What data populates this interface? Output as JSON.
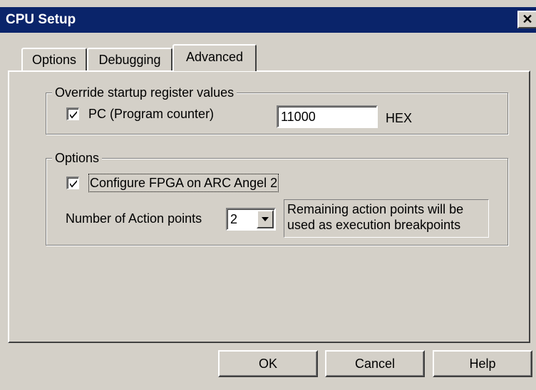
{
  "window": {
    "title": "CPU Setup",
    "close_glyph": "✕"
  },
  "tabs": [
    {
      "label": "Options",
      "active": false
    },
    {
      "label": "Debugging",
      "active": false
    },
    {
      "label": "Advanced",
      "active": true
    }
  ],
  "override_group": {
    "legend": "Override startup register values",
    "pc_checkbox_label": "PC (Program counter)",
    "pc_checked": true,
    "pc_value": "11000",
    "pc_unit": "HEX"
  },
  "options_group": {
    "legend": "Options",
    "fpga_checkbox_label": "Configure FPGA on ARC Angel 2",
    "fpga_checked": true,
    "action_points_label": "Number of Action points",
    "action_points_value": "2",
    "note_line1": "Remaining action points will be",
    "note_line2": "used as execution breakpoints"
  },
  "buttons": {
    "ok": "OK",
    "cancel": "Cancel",
    "help": "Help"
  },
  "icons": {
    "check": "checkmark-icon",
    "dropdown": "dropdown-arrow-icon"
  }
}
